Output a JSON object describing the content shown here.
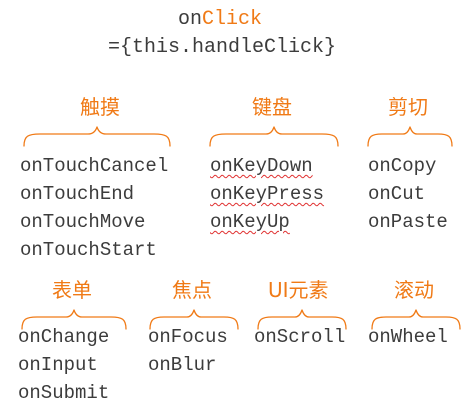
{
  "header": {
    "prop_prefix": "on",
    "prop_accent": "Click",
    "prop_value": "={this.handleClick}"
  },
  "colors": {
    "accent": "#f07a16",
    "text": "#3c3c3c",
    "spellcheck": "#e03030"
  },
  "groups": [
    {
      "heading": "触摸",
      "events": [
        "onTouchCancel",
        "onTouchEnd",
        "onTouchMove",
        "onTouchStart"
      ],
      "spellcheck": false
    },
    {
      "heading": "键盘",
      "events": [
        "onKeyDown",
        "onKeyPress",
        "onKeyUp"
      ],
      "spellcheck": true
    },
    {
      "heading": "剪切",
      "events": [
        "onCopy",
        "onCut",
        "onPaste"
      ],
      "spellcheck": false
    },
    {
      "heading": "表单",
      "events": [
        "onChange",
        "onInput",
        "onSubmit"
      ],
      "spellcheck": false
    },
    {
      "heading": "焦点",
      "events": [
        "onFocus",
        "onBlur"
      ],
      "spellcheck": false
    },
    {
      "heading": "UI元素",
      "events": [
        "onScroll"
      ],
      "spellcheck": false
    },
    {
      "heading": "滚动",
      "events": [
        "onWheel"
      ],
      "spellcheck": false
    }
  ]
}
